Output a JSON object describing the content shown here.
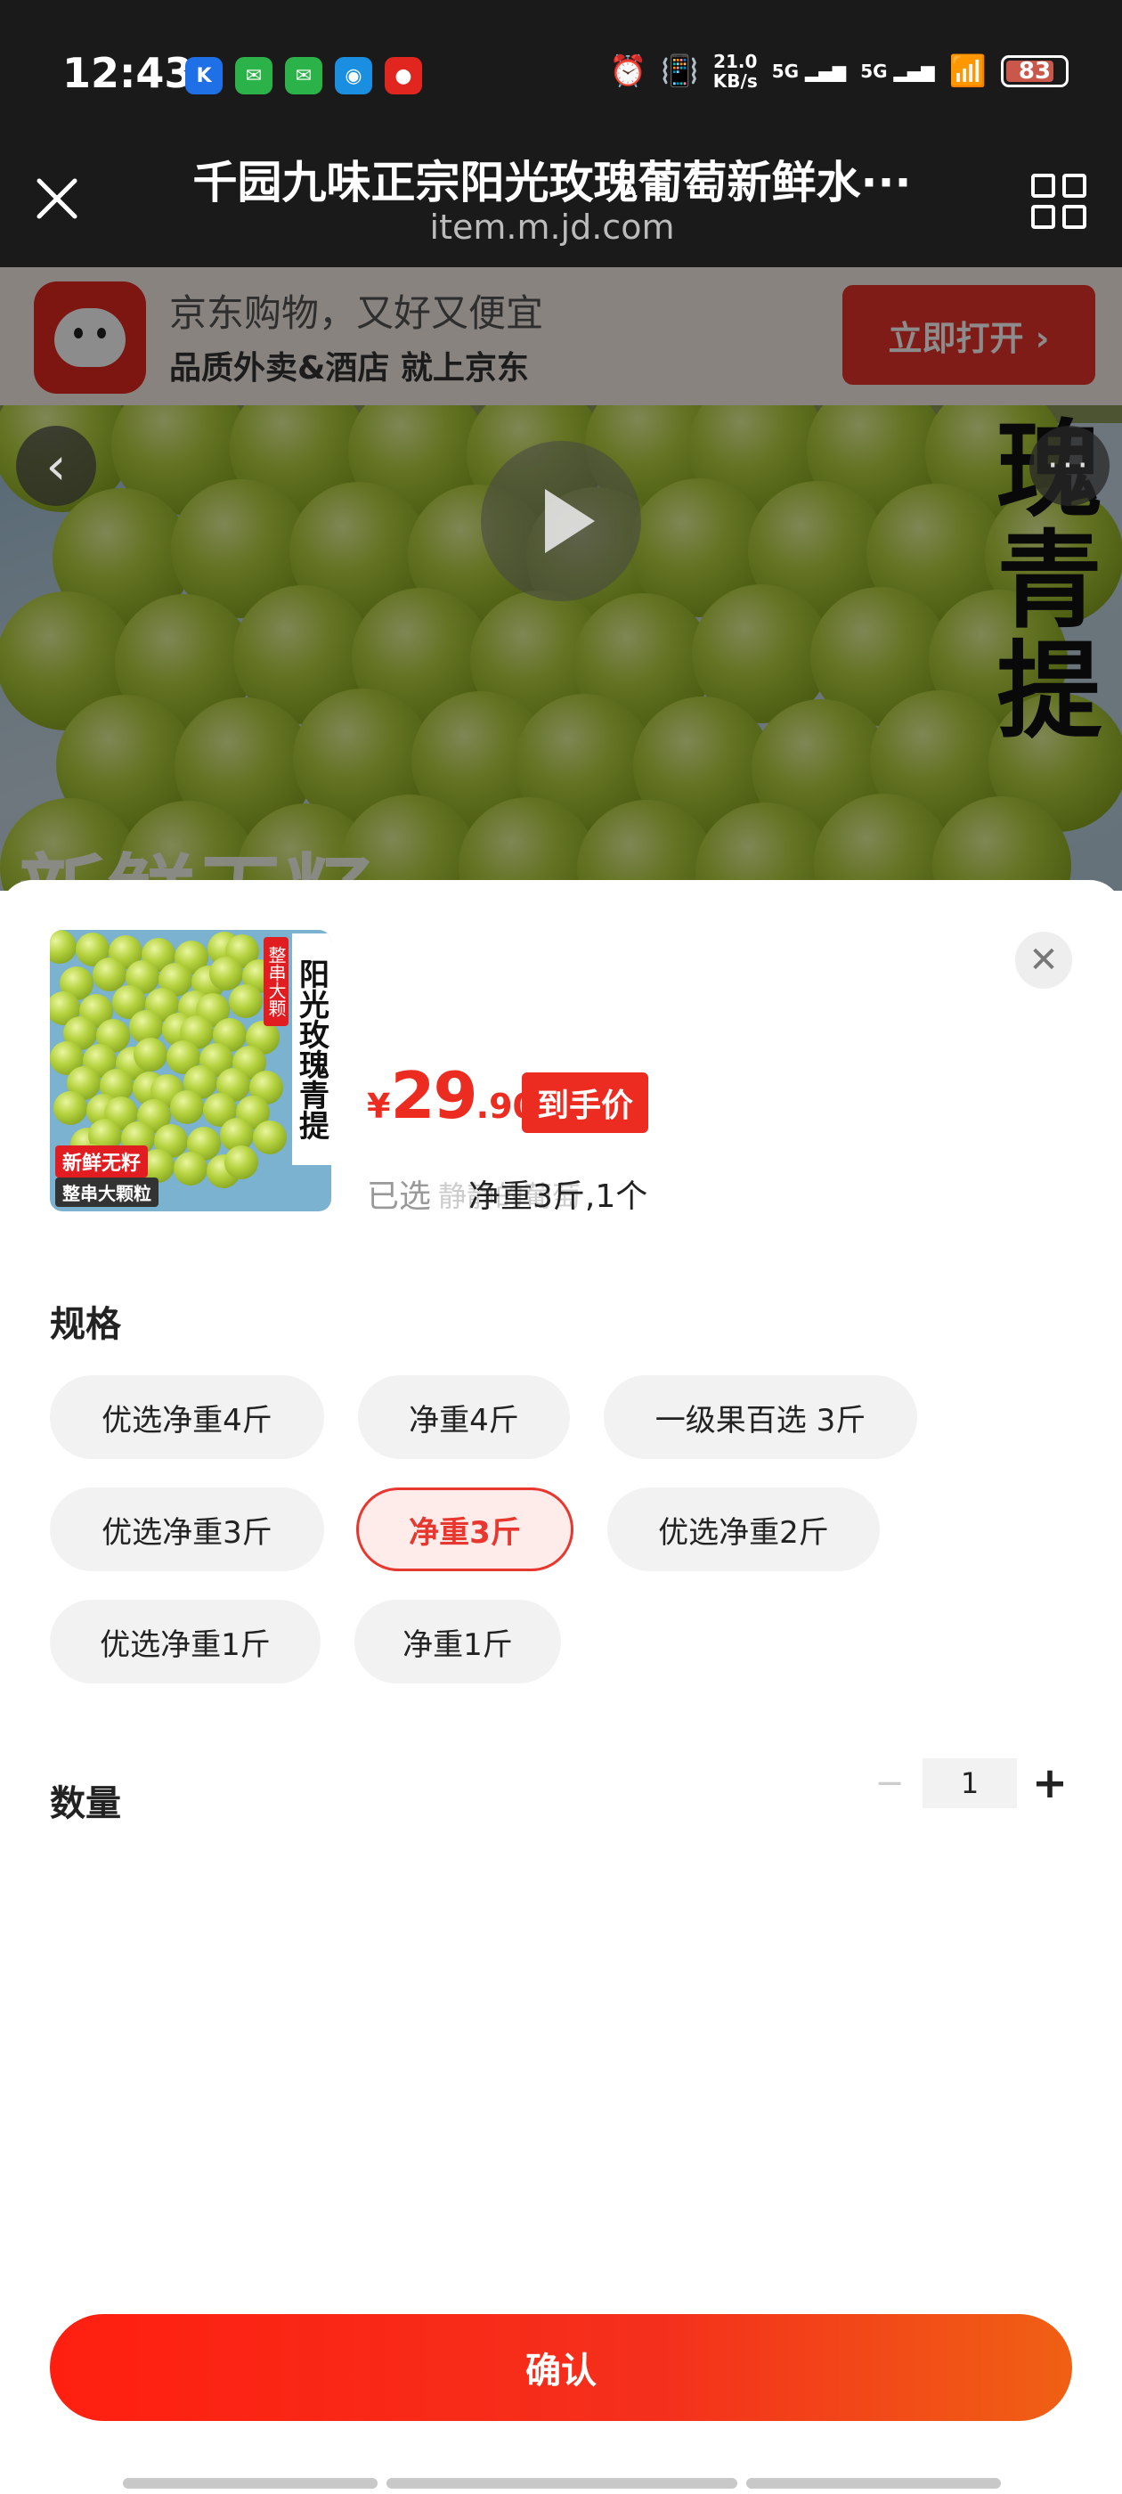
{
  "status": {
    "time": "12:43",
    "notifications": [
      {
        "name": "k-app-icon",
        "glyph": "K",
        "color": "#1f6fe6"
      },
      {
        "name": "wechat-icon",
        "glyph": "✉",
        "color": "#2bb34a"
      },
      {
        "name": "wechat-icon-2",
        "glyph": "✉",
        "color": "#2bb34a"
      },
      {
        "name": "qq-icon",
        "glyph": "◉",
        "color": "#1a8ee0"
      },
      {
        "name": "jd-notif-icon",
        "glyph": "●",
        "color": "#e0261f"
      }
    ],
    "net_speed_top": "21.0",
    "net_speed_bottom": "KB/s",
    "sig1": "5G",
    "sig2": "5G",
    "battery": "83",
    "battery_level": 0.83
  },
  "titlebar": {
    "title": "千园九味正宗阳光玫瑰葡萄新鲜水···",
    "url": "item.m.jd.com"
  },
  "banner": {
    "line1": "京东购物，又好又便宜",
    "line2": "品质外卖&酒店 就上京东",
    "open_button": "立即打开 ›"
  },
  "hero": {
    "vertical_text": "瑰青提",
    "bottom_text": "新鲜无籽"
  },
  "product": {
    "thumb_tag": "整串大颗",
    "thumb_title": "阳光玫瑰青提",
    "thumb_badge1": "新鲜无籽",
    "thumb_badge2": "整串大颗粒",
    "price_symbol": "¥",
    "price_int": "29",
    "price_dec": ".90",
    "price_tag": "到手价",
    "selected_label": "已选",
    "selected_watermark": "静静的葡萄",
    "selected_value": "净重3斤,1个"
  },
  "spec": {
    "title": "规格",
    "options": [
      {
        "label": "优选净重4斤",
        "active": false
      },
      {
        "label": "净重4斤",
        "active": false
      },
      {
        "label": "一级果百选 3斤",
        "active": false
      },
      {
        "label": "优选净重3斤",
        "active": false
      },
      {
        "label": "净重3斤",
        "active": true
      },
      {
        "label": "优选净重2斤",
        "active": false
      },
      {
        "label": "优选净重1斤",
        "active": false
      },
      {
        "label": "净重1斤",
        "active": false
      }
    ]
  },
  "quantity": {
    "title": "数量",
    "minus": "−",
    "value": "1",
    "plus": "+"
  },
  "confirm_label": "确认",
  "colors": {
    "accent": "#ec2c21",
    "chip_bg": "#f2f2f2",
    "status_bg": "#1a1a1a"
  }
}
